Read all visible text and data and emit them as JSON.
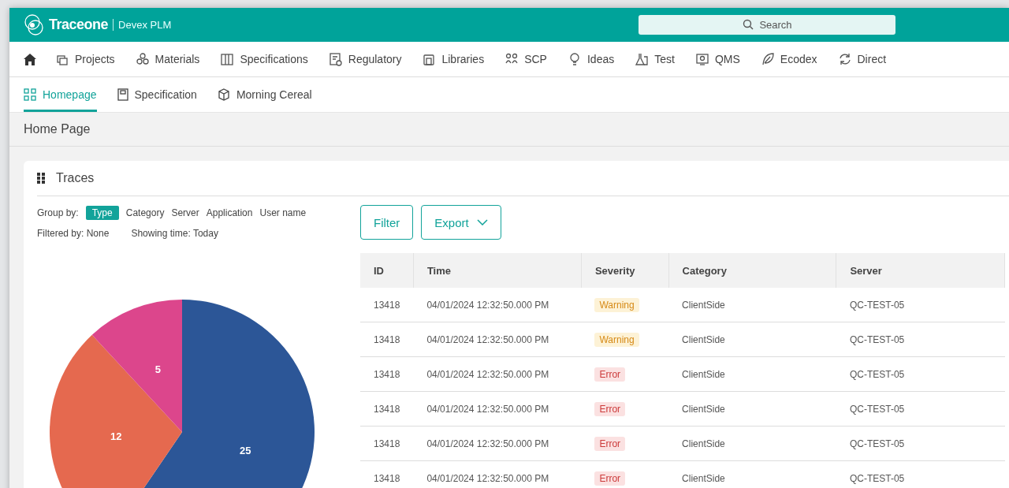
{
  "header": {
    "brand": "Traceone",
    "product": "Devex PLM",
    "search": {
      "placeholder": "Search"
    }
  },
  "nav": [
    {
      "label": "Projects"
    },
    {
      "label": "Materials"
    },
    {
      "label": "Specifications"
    },
    {
      "label": "Regulatory"
    },
    {
      "label": "Libraries"
    },
    {
      "label": "SCP"
    },
    {
      "label": "Ideas"
    },
    {
      "label": "Test"
    },
    {
      "label": "QMS"
    },
    {
      "label": "Ecodex"
    },
    {
      "label": "Direct"
    }
  ],
  "tabs": [
    {
      "label": "Homepage",
      "selected": true
    },
    {
      "label": "Specification",
      "selected": false
    },
    {
      "label": "Morning Cereal",
      "selected": false
    }
  ],
  "page_title": "Home Page",
  "traces": {
    "title": "Traces",
    "group_by_label": "Group by:",
    "group_by": [
      {
        "label": "Type",
        "selected": true
      },
      {
        "label": "Category",
        "selected": false
      },
      {
        "label": "Server",
        "selected": false
      },
      {
        "label": "Application",
        "selected": false
      },
      {
        "label": "User name",
        "selected": false
      }
    ],
    "filtered_by": "Filtered by: None",
    "showing_time": "Showing time: Today",
    "chart_data": {
      "type": "pie",
      "data_labels": true,
      "values": [
        25,
        12,
        5
      ],
      "colors": [
        "#2c5697",
        "#e5694f",
        "#dc468c"
      ]
    },
    "buttons": [
      {
        "label": "Filter",
        "kind": "plain"
      },
      {
        "label": "Export",
        "kind": "dropdown"
      }
    ],
    "table": {
      "columns": [
        "ID",
        "Time",
        "Severity",
        "Category",
        "Server"
      ],
      "rows": [
        {
          "id": "13418",
          "time": "04/01/2024 12:32:50.000 PM",
          "severity": {
            "label": "Warning",
            "kind": "warning"
          },
          "category": "ClientSide",
          "server": "QC-TEST-05"
        },
        {
          "id": "13418",
          "time": "04/01/2024 12:32:50.000 PM",
          "severity": {
            "label": "Warning",
            "kind": "warning"
          },
          "category": "ClientSide",
          "server": "QC-TEST-05"
        },
        {
          "id": "13418",
          "time": "04/01/2024 12:32:50.000 PM",
          "severity": {
            "label": "Error",
            "kind": "error"
          },
          "category": "ClientSide",
          "server": "QC-TEST-05"
        },
        {
          "id": "13418",
          "time": "04/01/2024 12:32:50.000 PM",
          "severity": {
            "label": "Error",
            "kind": "error"
          },
          "category": "ClientSide",
          "server": "QC-TEST-05"
        },
        {
          "id": "13418",
          "time": "04/01/2024 12:32:50.000 PM",
          "severity": {
            "label": "Error",
            "kind": "error"
          },
          "category": "ClientSide",
          "server": "QC-TEST-05"
        },
        {
          "id": "13418",
          "time": "04/01/2024 12:32:50.000 PM",
          "severity": {
            "label": "Error",
            "kind": "error"
          },
          "category": "ClientSide",
          "server": "QC-TEST-05"
        }
      ]
    }
  }
}
